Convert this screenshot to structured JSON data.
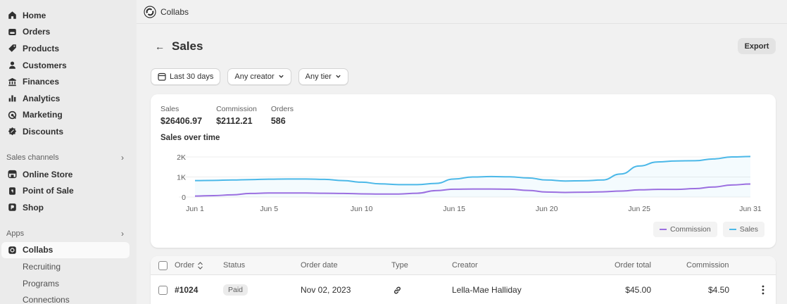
{
  "sidebar": {
    "items": [
      {
        "label": "Home",
        "icon": "home-icon"
      },
      {
        "label": "Orders",
        "icon": "orders-icon"
      },
      {
        "label": "Products",
        "icon": "tag-icon"
      },
      {
        "label": "Customers",
        "icon": "person-icon"
      },
      {
        "label": "Finances",
        "icon": "bank-icon"
      },
      {
        "label": "Analytics",
        "icon": "bar-chart-icon"
      },
      {
        "label": "Marketing",
        "icon": "target-icon"
      },
      {
        "label": "Discounts",
        "icon": "discount-icon"
      }
    ],
    "sales_channels_label": "Sales channels",
    "channels": [
      {
        "label": "Online Store",
        "icon": "store-icon"
      },
      {
        "label": "Point of Sale",
        "icon": "pos-icon"
      },
      {
        "label": "Shop",
        "icon": "shop-icon"
      }
    ],
    "apps_label": "Apps",
    "app": {
      "label": "Collabs",
      "icon": "collabs-icon"
    },
    "sub_items": [
      "Recruiting",
      "Programs",
      "Connections"
    ]
  },
  "topbar": {
    "app_name": "Collabs"
  },
  "page": {
    "title": "Sales",
    "export_label": "Export"
  },
  "filters": [
    {
      "label": "Last 30 days",
      "icon": "calendar-icon"
    },
    {
      "label": "Any creator",
      "icon": "chevron-down-icon"
    },
    {
      "label": "Any tier",
      "icon": "chevron-down-icon"
    }
  ],
  "metrics": [
    {
      "label": "Sales",
      "value": "$26406.97"
    },
    {
      "label": "Commission",
      "value": "$2112.21"
    },
    {
      "label": "Orders",
      "value": "586"
    }
  ],
  "chart_data": {
    "type": "line",
    "title": "Sales over time",
    "x": [
      "Jun 1",
      "Jun 2",
      "Jun 3",
      "Jun 4",
      "Jun 5",
      "Jun 6",
      "Jun 7",
      "Jun 8",
      "Jun 9",
      "Jun 10",
      "Jun 11",
      "Jun 12",
      "Jun 13",
      "Jun 14",
      "Jun 15",
      "Jun 16",
      "Jun 17",
      "Jun 18",
      "Jun 19",
      "Jun 20",
      "Jun 21",
      "Jun 22",
      "Jun 23",
      "Jun 24",
      "Jun 25",
      "Jun 26",
      "Jun 27",
      "Jun 28",
      "Jun 29",
      "Jun 30",
      "Jun 31"
    ],
    "x_tick_labels": [
      "Jun 1",
      "Jun 5",
      "Jun 10",
      "Jun 15",
      "Jun 20",
      "Jun 25",
      "Jun 31"
    ],
    "y_tick_labels": [
      "2K",
      "1K",
      "0"
    ],
    "ylim": [
      0,
      2000
    ],
    "series": [
      {
        "name": "Sales",
        "color": "#4bb8e8",
        "values": [
          820,
          830,
          850,
          870,
          890,
          900,
          900,
          880,
          820,
          740,
          660,
          620,
          620,
          680,
          900,
          1000,
          1020,
          1010,
          950,
          850,
          800,
          810,
          850,
          1150,
          1550,
          1750,
          1800,
          1810,
          1900,
          2000,
          2020
        ]
      },
      {
        "name": "Commission",
        "color": "#9b6fe0",
        "values": [
          50,
          70,
          110,
          180,
          200,
          200,
          200,
          190,
          180,
          160,
          150,
          150,
          190,
          320,
          390,
          400,
          400,
          390,
          330,
          250,
          230,
          240,
          260,
          300,
          360,
          380,
          380,
          420,
          500,
          600,
          650
        ]
      }
    ],
    "legend": [
      "Commission",
      "Sales"
    ],
    "legend_position": "bottom-right",
    "grid": true
  },
  "table": {
    "columns": [
      "Order",
      "Status",
      "Order date",
      "Type",
      "Creator",
      "Order total",
      "Commission"
    ],
    "rows": [
      {
        "order": "#1024",
        "status": "Paid",
        "date": "Nov 02, 2023",
        "type": "link-icon",
        "creator": "Lella-Mae Halliday",
        "total": "$45.00",
        "commission": "$4.50"
      }
    ]
  }
}
